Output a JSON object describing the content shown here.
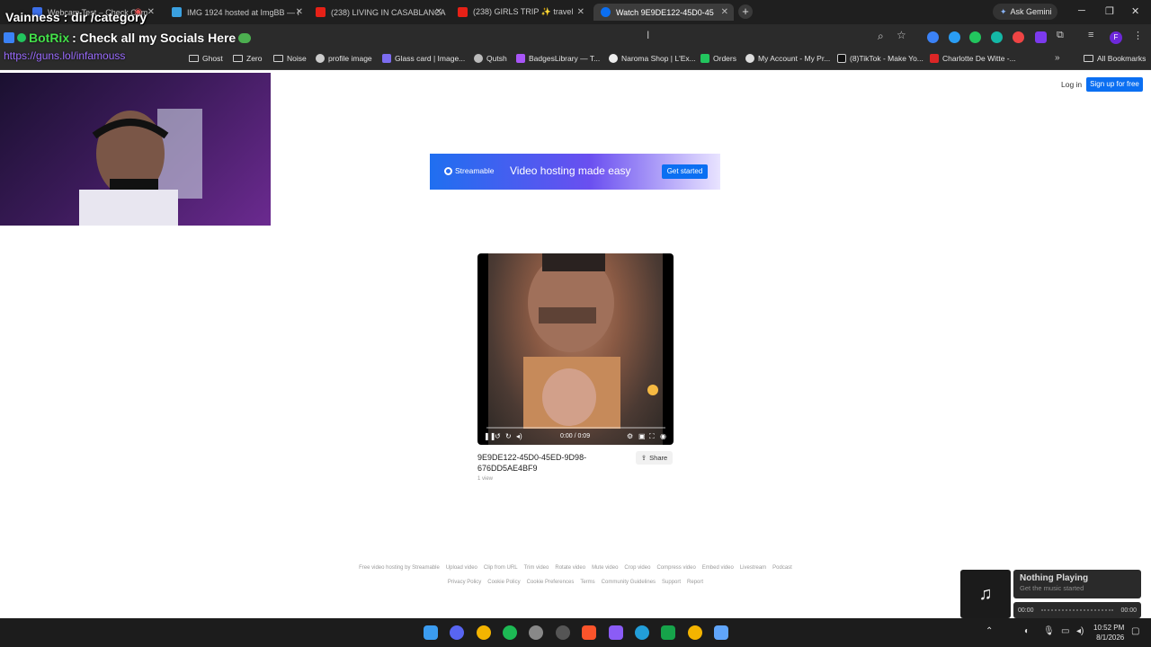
{
  "browser": {
    "tabs": [
      {
        "label": "Webcam Test – Check Cam"
      },
      {
        "label": "IMG 1924 hosted at ImgBB — I"
      },
      {
        "label": "(238) LIVING IN CASABLANCA"
      },
      {
        "label": "(238) GIRLS TRIP ✨ travel"
      },
      {
        "label": "Watch 9E9DE122-45D0-45"
      }
    ],
    "ask_gemini": "Ask Gemini",
    "bookmarks": [
      "Ghost",
      "Zero",
      "Noise",
      "profile image",
      "Glass card | Image...",
      "Qutsh",
      "BadgesLibrary — T...",
      "Naroma Shop | L'Ex...",
      "Orders",
      "My Account - My Pr...",
      "(8)TikTok - Make Yo...",
      "Charlotte De Witte -..."
    ],
    "all_bookmarks": "All Bookmarks"
  },
  "overlay": {
    "line1": "Vainness : dir /category",
    "line2_name": "BotRix",
    "line2_text": ": Check all my Socials Here",
    "link": "https://guns.lol/infamouss"
  },
  "page": {
    "login": "Log in",
    "signup": "Sign up for free",
    "banner": {
      "brand": "Streamable",
      "tagline": "Video hosting made easy",
      "cta": "Get started"
    },
    "player": {
      "time": "0:00 / 0:09"
    },
    "video_title": "9E9DE122-45D0-45ED-9D98-676DD5AE4BF9",
    "views": "1 view",
    "share": "Share",
    "footer_row1": [
      "Free video hosting by Streamable",
      "Upload video",
      "Clip from URL",
      "Trim video",
      "Rotate video",
      "Mute video",
      "Crop video",
      "Compress video",
      "Embed video",
      "Livestream",
      "Podcast"
    ],
    "footer_row2": [
      "Privacy Policy",
      "Cookie Policy",
      "Cookie Preferences",
      "Terms",
      "Community Guidelines",
      "Support",
      "Report"
    ]
  },
  "music": {
    "title": "Nothing Playing",
    "subtitle": "Get the music started",
    "start": "00:00",
    "end": "00:00"
  },
  "taskbar": {
    "time": "10:52 PM",
    "date": "8/1/2026"
  }
}
